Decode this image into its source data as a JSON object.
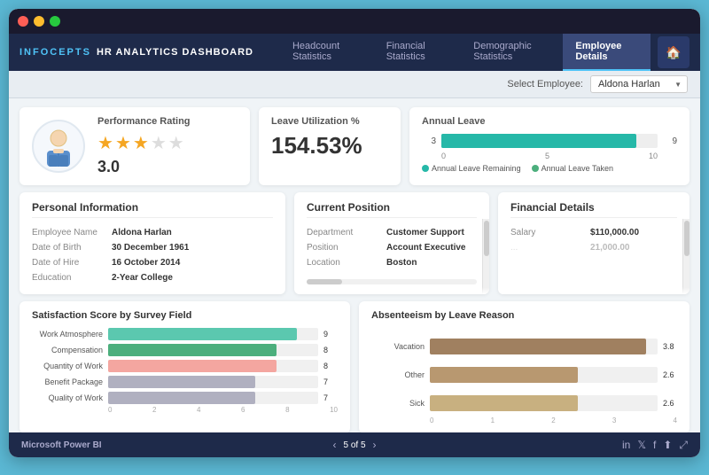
{
  "app": {
    "brand_logo": "INFOCEPTS",
    "brand_title": "HR ANALYTICS DASHBOARD"
  },
  "navbar": {
    "tabs": [
      {
        "id": "headcount",
        "label": "Headcount Statistics",
        "active": false
      },
      {
        "id": "financial",
        "label": "Financial Statistics",
        "active": false
      },
      {
        "id": "demographic",
        "label": "Demographic Statistics",
        "active": false
      },
      {
        "id": "employee",
        "label": "Employee Details",
        "active": true
      }
    ]
  },
  "select_employee": {
    "label": "Select Employee:",
    "value": "Aldona Harlan"
  },
  "performance": {
    "label": "Performance Rating",
    "score": "3.0"
  },
  "leave_utilization": {
    "label": "Leave Utilization %",
    "value": "154.53%"
  },
  "annual_leave": {
    "label": "Annual Leave",
    "remaining": 3,
    "taken": 9,
    "max": 10,
    "legend_remaining": "Annual Leave Remaining",
    "legend_taken": "Annual Leave Taken",
    "axis_labels": [
      "0",
      "5",
      "10"
    ]
  },
  "personal_info": {
    "title": "Personal Information",
    "fields": [
      {
        "label": "Employee Name",
        "value": "Aldona Harlan"
      },
      {
        "label": "Date of Birth",
        "value": "30 December 1961"
      },
      {
        "label": "Date of Hire",
        "value": "16 October 2014"
      },
      {
        "label": "Education",
        "value": "2-Year College"
      }
    ]
  },
  "current_position": {
    "title": "Current Position",
    "fields": [
      {
        "label": "Department",
        "value": "Customer Support"
      },
      {
        "label": "Position",
        "value": "Account Executive"
      },
      {
        "label": "Location",
        "value": "Boston"
      }
    ]
  },
  "financial_details": {
    "title": "Financial Details",
    "fields": [
      {
        "label": "Salary",
        "value": "$110,000.00"
      },
      {
        "label": "...",
        "value": "21,000.00"
      }
    ]
  },
  "satisfaction": {
    "title": "Satisfaction Score by Survey Field",
    "bars": [
      {
        "label": "Work Atmosphere",
        "value": 9,
        "max": 10,
        "color": "#5bc8af"
      },
      {
        "label": "Compensation",
        "value": 8,
        "max": 10,
        "color": "#4caf7d"
      },
      {
        "label": "Quantity of Work",
        "value": 8,
        "max": 10,
        "color": "#f4a6a0"
      },
      {
        "label": "Benefit Package",
        "value": 7,
        "max": 10,
        "color": "#c8c8d0"
      },
      {
        "label": "Quality of Work",
        "value": 7,
        "max": 10,
        "color": "#c8c8d0"
      }
    ],
    "axis_labels": [
      "0",
      "2",
      "4",
      "6",
      "8",
      "10"
    ]
  },
  "absenteeism": {
    "title": "Absenteeism by Leave Reason",
    "bars": [
      {
        "label": "Vacation",
        "value": 3.8,
        "max": 4,
        "color": "#a08060"
      },
      {
        "label": "Other",
        "value": 2.6,
        "max": 4,
        "color": "#b89870"
      },
      {
        "label": "Sick",
        "value": 2.6,
        "max": 4,
        "color": "#c8b080"
      }
    ],
    "axis_labels": [
      "0",
      "1",
      "2",
      "3",
      "4"
    ]
  },
  "bottom_bar": {
    "brand": "Microsoft Power BI",
    "page": "5 of 5"
  }
}
